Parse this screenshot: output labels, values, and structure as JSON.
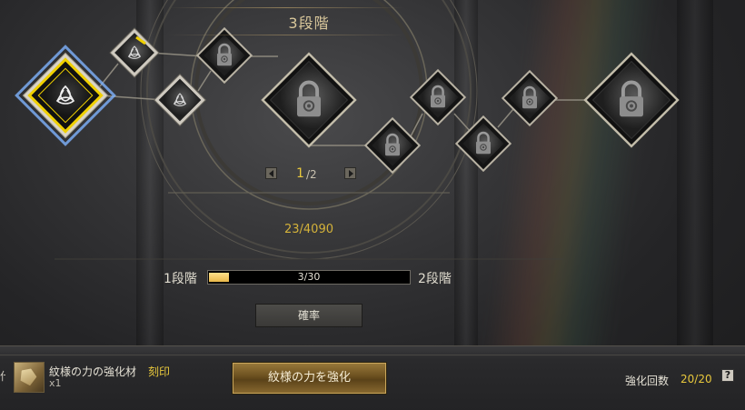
{
  "stage_title": "3段階",
  "pagination": {
    "current": "1",
    "separator": "/2"
  },
  "points": "23/4090",
  "progress": {
    "left_label": "1段階",
    "right_label": "2段階",
    "text": "3/30",
    "fraction": 0.1
  },
  "probability_button": "確率",
  "material": {
    "name": "紋様の力の強化材",
    "tag": "刻印",
    "quantity": "x1"
  },
  "enhance_button": "紋様の力を強化",
  "count": {
    "label": "強化回数",
    "value": "20/20"
  },
  "help_label": "?",
  "edge_char": "什",
  "colors": {
    "gold": "#e8c83c",
    "selected_border": "#f0d000",
    "selected_glow": "#7fb4ff"
  },
  "nodes": [
    {
      "id": "node-selected",
      "state": "unlocked-selected",
      "icon": "triquetra-icon"
    },
    {
      "id": "node-2",
      "state": "unlocked",
      "icon": "triquetra-icon"
    },
    {
      "id": "node-3",
      "state": "unlocked",
      "icon": "triquetra-icon"
    },
    {
      "id": "node-4",
      "state": "locked",
      "icon": "lock-icon"
    },
    {
      "id": "node-5",
      "state": "locked-large",
      "icon": "lock-icon"
    },
    {
      "id": "node-6",
      "state": "locked",
      "icon": "lock-icon"
    },
    {
      "id": "node-7",
      "state": "locked",
      "icon": "lock-icon"
    },
    {
      "id": "node-8",
      "state": "locked",
      "icon": "lock-icon"
    },
    {
      "id": "node-9",
      "state": "locked",
      "icon": "lock-icon"
    },
    {
      "id": "node-10",
      "state": "locked-large",
      "icon": "lock-icon"
    }
  ]
}
